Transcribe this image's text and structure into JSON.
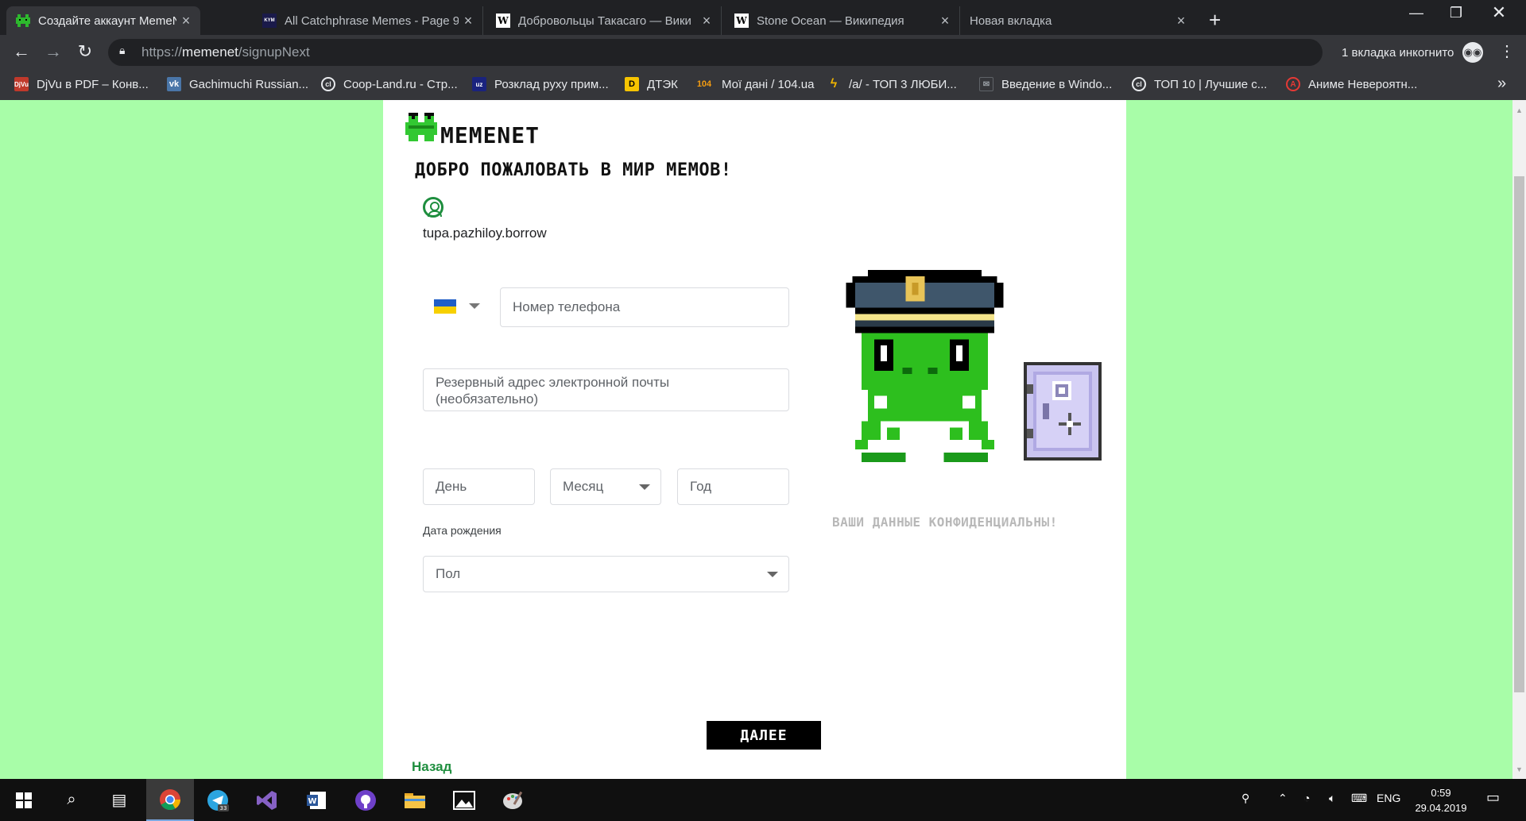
{
  "browser": {
    "tabs": [
      {
        "title": "Создайте аккаунт MemeNet",
        "active": true,
        "icon": "memenet-frog-icon"
      },
      {
        "title": "All Catchphrase Memes - Page 9",
        "active": false,
        "icon": "knowyourmeme-icon"
      },
      {
        "title": "Добровольцы Такасаго — Вики",
        "active": false,
        "icon": "wikipedia-icon"
      },
      {
        "title": "Stone Ocean — Википедия",
        "active": false,
        "icon": "wikipedia-icon"
      },
      {
        "title": "Новая вкладка",
        "active": false,
        "icon": "none"
      }
    ],
    "url_scheme": "https://",
    "url_host": "memenet",
    "url_path": "/signupNext",
    "incognito_label": "1 вкладка инкогнито",
    "bookmarks": [
      {
        "label": "DjVu в PDF – Конв...",
        "icon": "djvu-icon",
        "color": "#c0392b"
      },
      {
        "label": "Gachimuchi Russian...",
        "icon": "vk-icon",
        "color": "#4a76a8"
      },
      {
        "label": "Coop-Land.ru - Стр...",
        "icon": "coop-land-icon",
        "color": "#202124"
      },
      {
        "label": "Розклад руху прим...",
        "icon": "train-icon",
        "color": "#1a237e"
      },
      {
        "label": "ДТЭК",
        "icon": "dtek-icon",
        "color": "#f6c400"
      },
      {
        "label": "Мої дані / 104.ua",
        "icon": "104-icon",
        "color": "#f39c12"
      },
      {
        "label": "/a/ - ТОП 3 ЛЮБИ...",
        "icon": "lightning-icon",
        "color": "#f0b400"
      },
      {
        "label": "Введение в Windo...",
        "icon": "mail-icon",
        "color": "#5f6368"
      },
      {
        "label": "ТОП 10 | Лучшие с...",
        "icon": "coop-land-icon",
        "color": "#202124"
      },
      {
        "label": "Аниме Невероятн...",
        "icon": "anime-icon",
        "color": "#e53935"
      }
    ]
  },
  "page": {
    "brand": "MEMENET",
    "welcome": "ДОБРО ПОЖАЛОВАТЬ В МИР МЕМОВ!",
    "username": "tupa.pazhiloy.borrow",
    "phone_placeholder": "Номер телефона",
    "backup_email_line1": "Резервный адрес электронной почты",
    "backup_email_line2": "(необязательно)",
    "day_placeholder": "День",
    "month_placeholder": "Месяц",
    "year_placeholder": "Год",
    "dob_label": "Дата рождения",
    "gender_placeholder": "Пол",
    "back_label": "Назад",
    "next_label": "ДАЛЕЕ",
    "confidential": "ВАШИ ДАННЫЕ КОНФИДЕНЦИАЛЬНЫ!",
    "bg_color": "#a8fda8",
    "accent": "#1e8e3e"
  },
  "taskbar": {
    "apps": [
      "windows-start-icon",
      "search-icon",
      "task-view-icon",
      "chrome-icon",
      "telegram-icon",
      "visual-studio-icon",
      "word-icon",
      "github-icon",
      "file-explorer-icon",
      "photos-icon",
      "paint-icon"
    ],
    "telegram_badge": "33",
    "lang": "ENG",
    "time": "0:59",
    "date": "29.04.2019"
  }
}
